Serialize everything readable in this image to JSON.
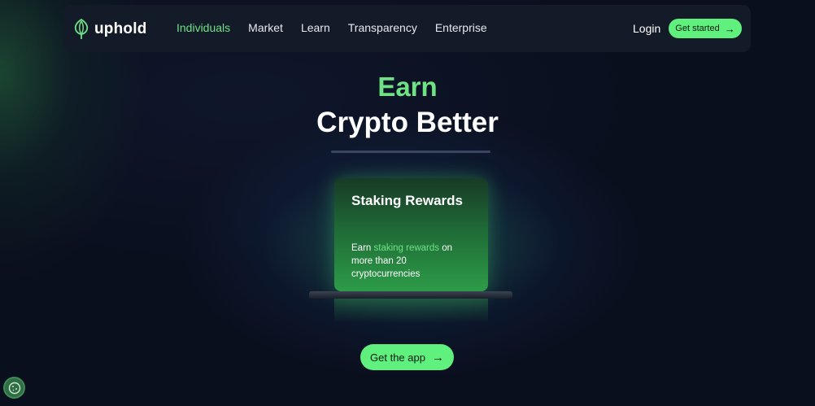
{
  "nav": {
    "logo_text": "uphold",
    "links": [
      {
        "label": "Individuals"
      },
      {
        "label": "Market"
      },
      {
        "label": "Learn"
      },
      {
        "label": "Transparency"
      },
      {
        "label": "Enterprise"
      }
    ],
    "login_label": "Login",
    "cta_label": "Get started"
  },
  "hero": {
    "line1": "Earn",
    "line2": "Crypto Better"
  },
  "card": {
    "title": "Staking Rewards",
    "body_prefix": "Earn ",
    "body_highlight": "staking rewards",
    "body_suffix": " on more than 20 cryptocurrencies"
  },
  "cta": {
    "label": "Get the app"
  },
  "icons": {
    "logo": "uphold-logo-icon",
    "arrow": "arrow-right-icon",
    "cookie": "cookie-icon"
  },
  "colors": {
    "accent": "#5ff07d",
    "accent_text": "#6fe285",
    "background": "#0a0f1e",
    "nav_bg": "#131a28"
  }
}
